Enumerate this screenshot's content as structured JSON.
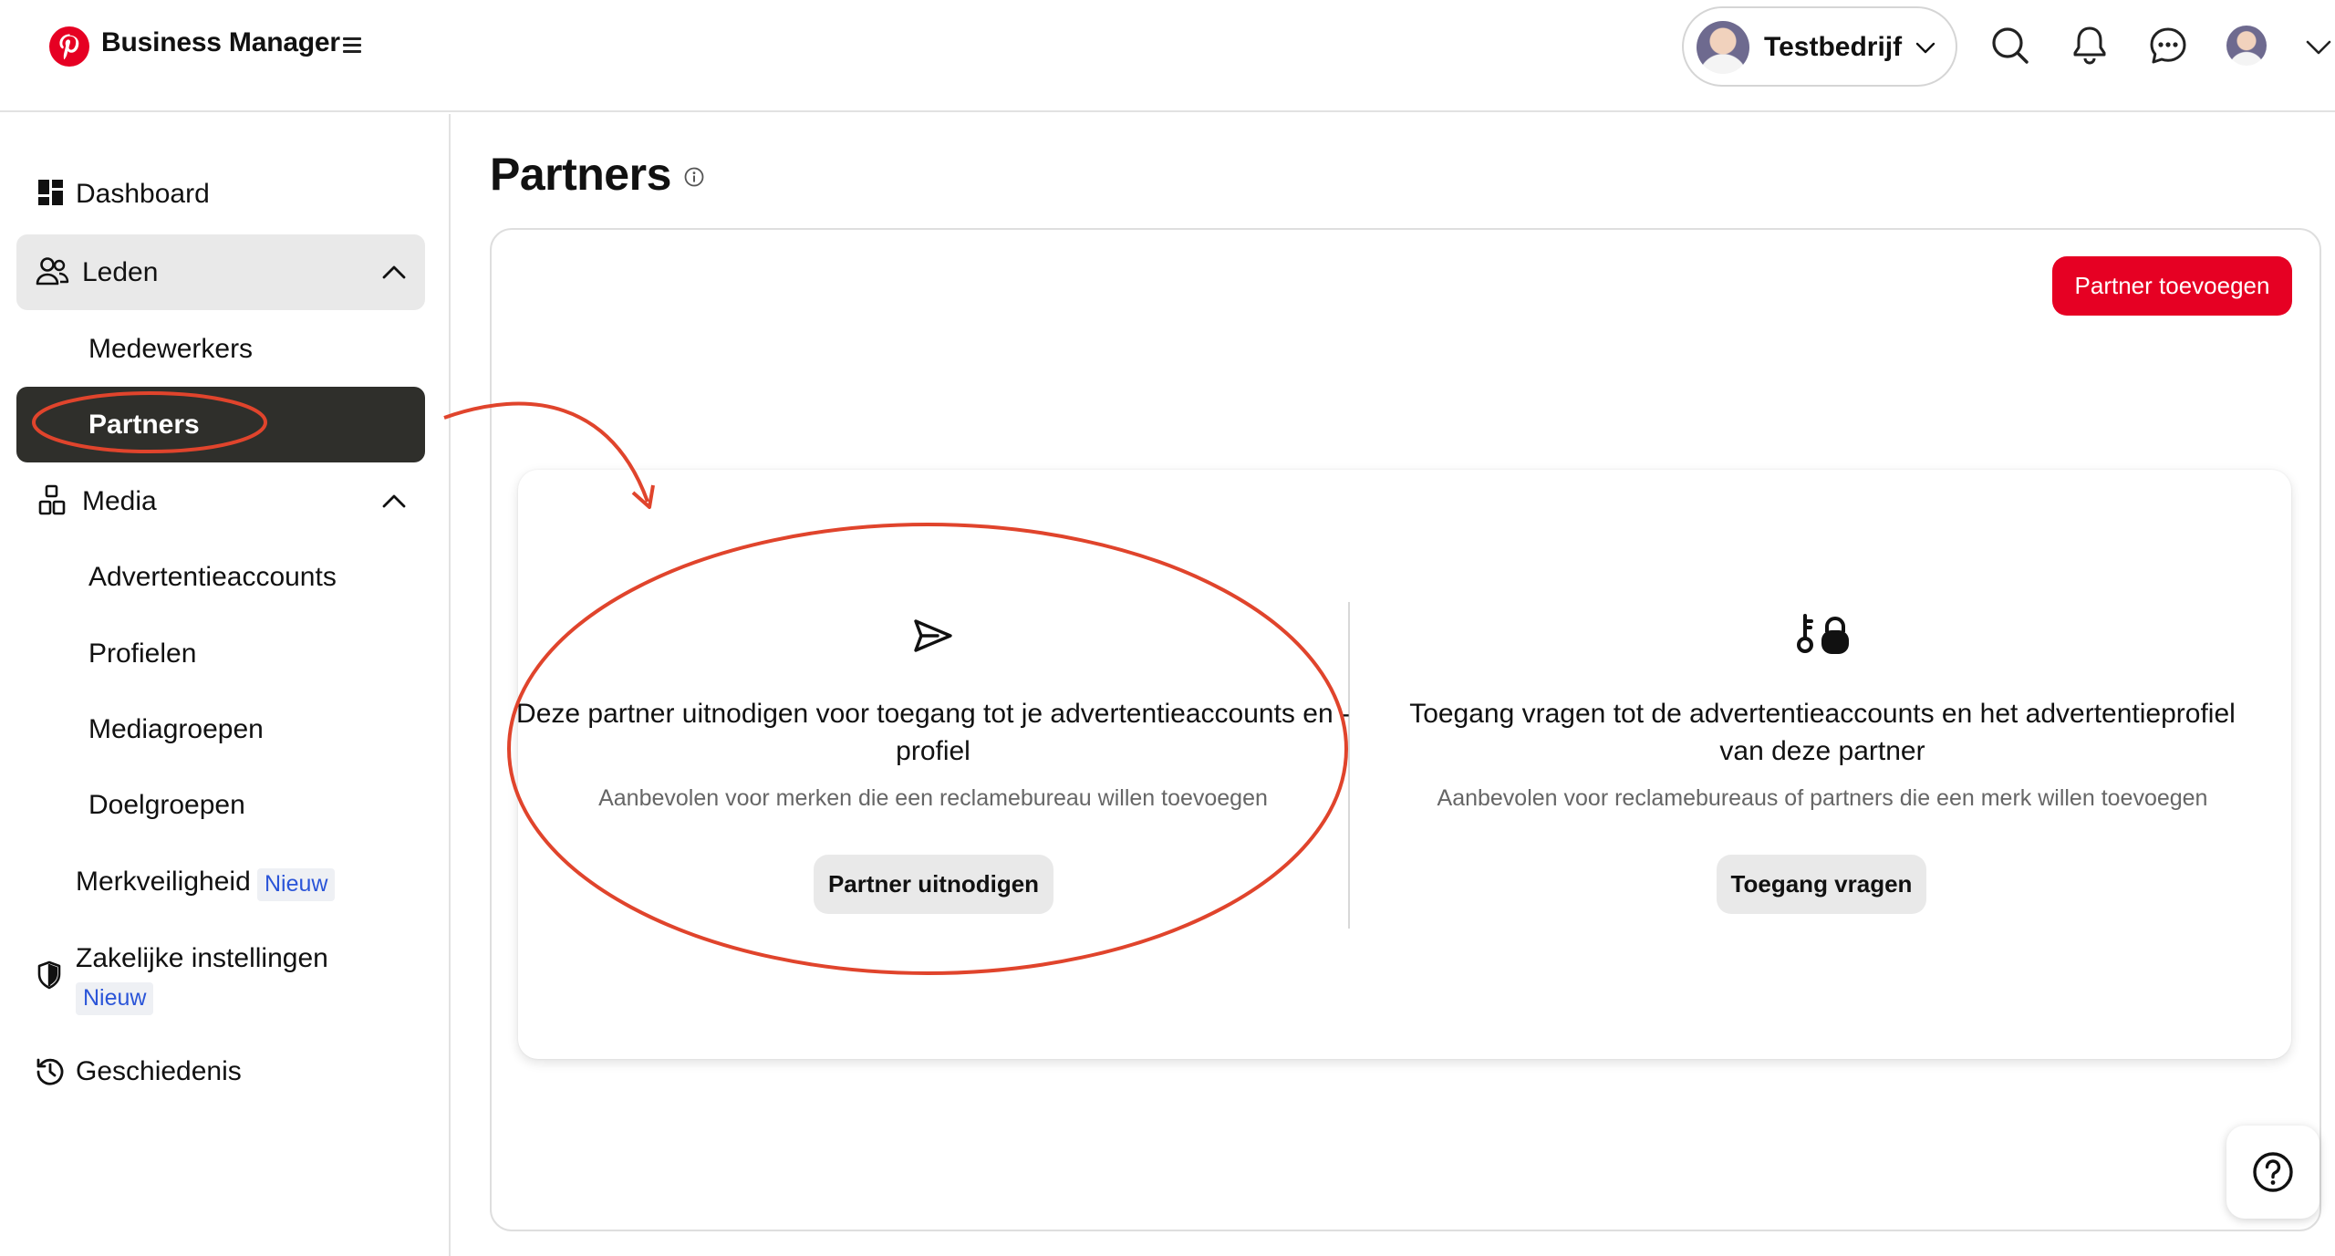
{
  "app": {
    "title": "Business Manager"
  },
  "header": {
    "company_name": "Testbedrijf",
    "icons": [
      "search-icon",
      "bell-icon",
      "chat-icon",
      "avatar",
      "chevron-down-icon"
    ]
  },
  "sidebar": {
    "items": [
      {
        "label": "Dashboard",
        "icon": "dashboard-icon"
      },
      {
        "label": "Leden",
        "icon": "people-icon",
        "expanded": true
      },
      {
        "label": "Medewerkers"
      },
      {
        "label": "Partners",
        "active": true
      },
      {
        "label": "Media",
        "icon": "media-icon",
        "expanded": true
      },
      {
        "label": "Advertentieaccounts"
      },
      {
        "label": "Profielen"
      },
      {
        "label": "Mediagroepen"
      },
      {
        "label": "Doelgroepen"
      },
      {
        "label": "Merkveiligheid",
        "badge": "Nieuw"
      },
      {
        "label": "Zakelijke instellingen",
        "badge": "Nieuw",
        "icon": "shield-icon"
      },
      {
        "label": "Geschiedenis",
        "icon": "history-icon"
      }
    ]
  },
  "main": {
    "title": "Partners",
    "add_button": "Partner toevoegen",
    "options": [
      {
        "icon": "send-icon",
        "title": "Deze partner uitnodigen voor toegang tot je advertentieaccounts en -profiel",
        "description": "Aanbevolen voor merken die een reclamebureau willen toevoegen",
        "button": "Partner uitnodigen"
      },
      {
        "icon": "key-lock-icon",
        "title": "Toegang vragen tot de advertentieaccounts en het advertentieprofiel van deze partner",
        "description": "Aanbevolen voor reclamebureaus of partners die een merk willen toevoegen",
        "button": "Toegang vragen"
      }
    ]
  },
  "colors": {
    "brand": "#e60023",
    "active_nav": "#2f2f2b",
    "annotation": "#e0442c",
    "badge_text": "#2b55d8"
  }
}
